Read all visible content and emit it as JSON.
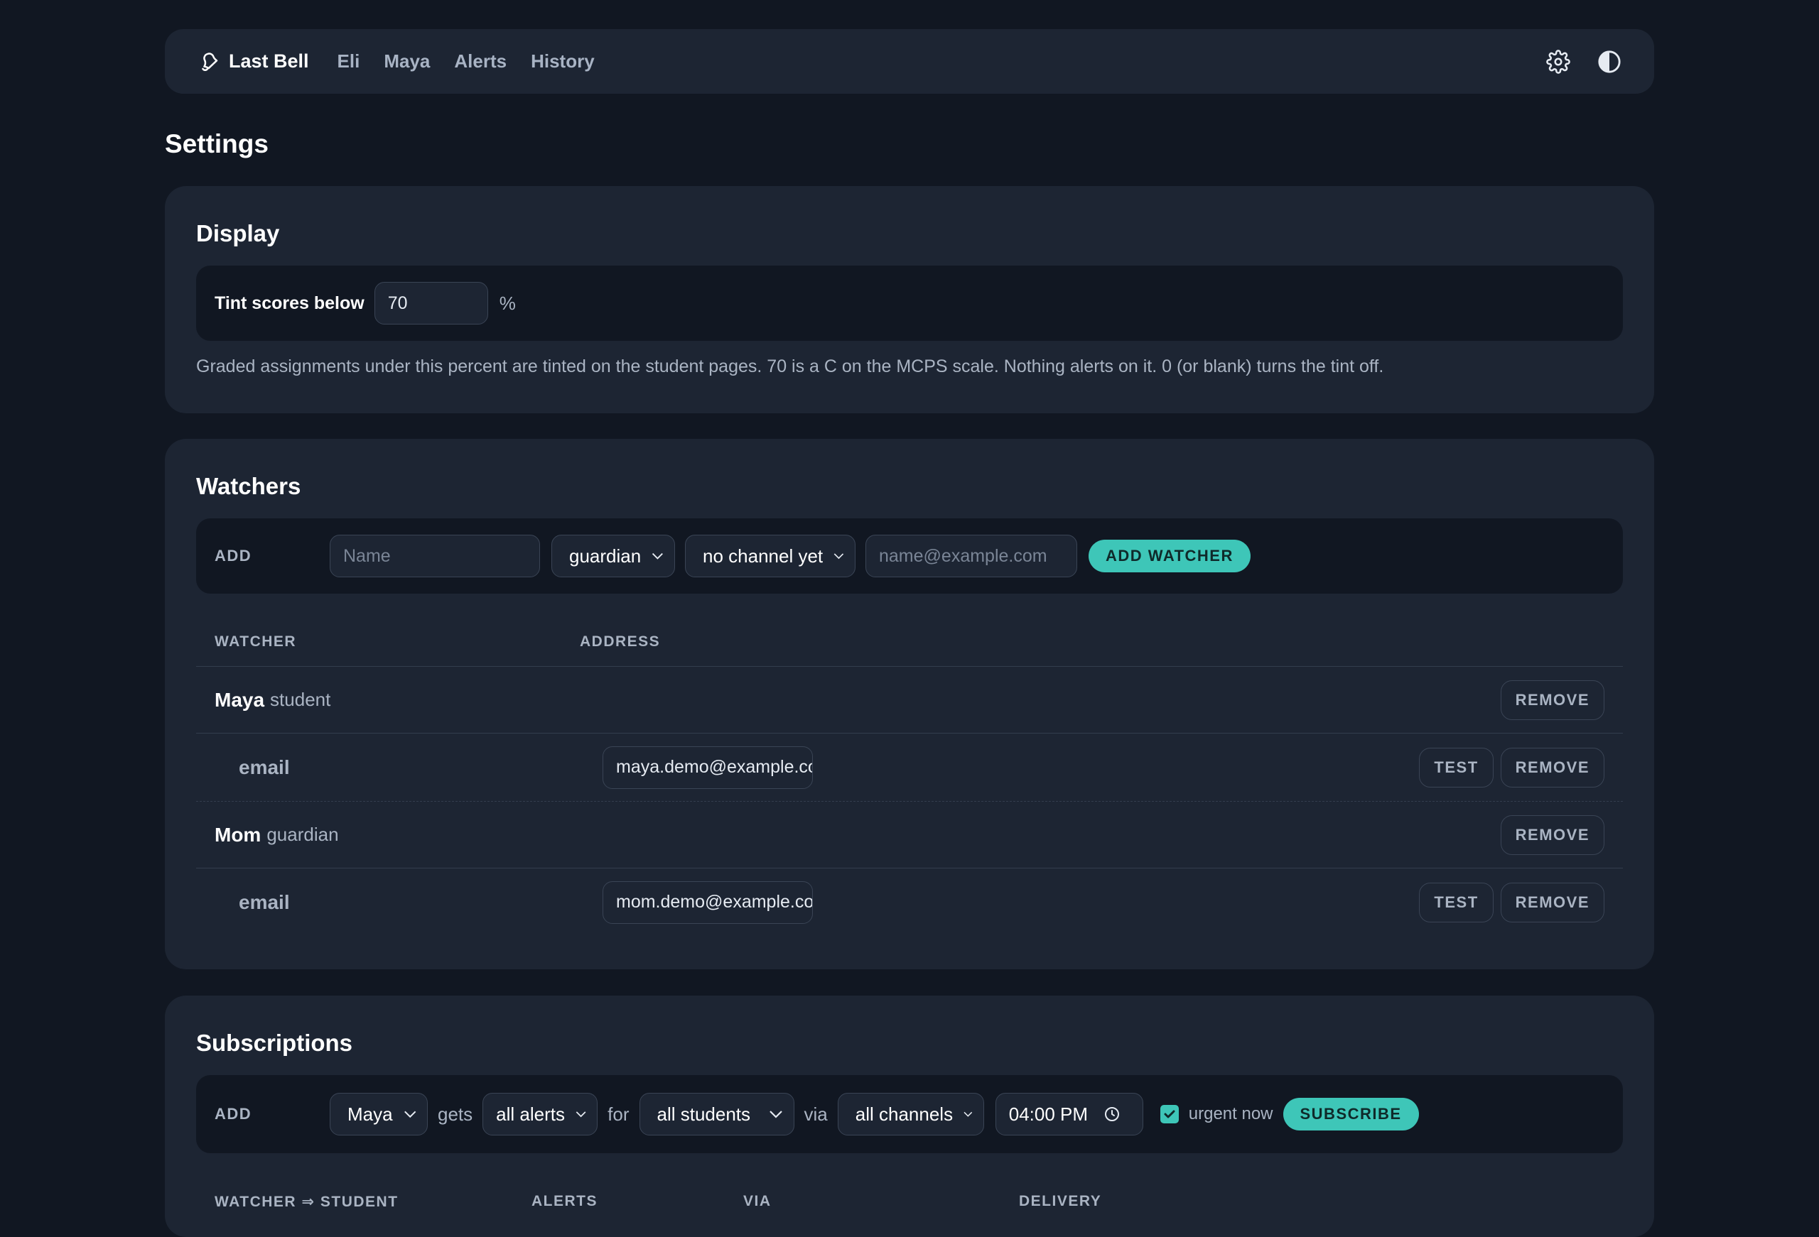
{
  "nav": {
    "brand": "Last Bell",
    "links": [
      "Eli",
      "Maya",
      "Alerts",
      "History"
    ]
  },
  "page_title": "Settings",
  "display": {
    "title": "Display",
    "tint_label": "Tint scores below",
    "tint_value": "70",
    "percent_sign": "%",
    "help": "Graded assignments under this percent are tinted on the student pages. 70 is a C on the MCPS scale. Nothing alerts on it. 0 (or blank) turns the tint off."
  },
  "watchers": {
    "title": "Watchers",
    "add_label": "ADD",
    "name_placeholder": "Name",
    "role_value": "guardian",
    "channel_value": "no channel yet",
    "email_placeholder": "name@example.com",
    "add_button": "ADD WATCHER",
    "col_watcher": "WATCHER",
    "col_address": "ADDRESS",
    "remove_label": "REMOVE",
    "test_label": "TEST",
    "rows": [
      {
        "name": "Maya",
        "role": "student",
        "channel": "email",
        "address": "maya.demo@example.com"
      },
      {
        "name": "Mom",
        "role": "guardian",
        "channel": "email",
        "address": "mom.demo@example.com"
      }
    ]
  },
  "subscriptions": {
    "title": "Subscriptions",
    "add_label": "ADD",
    "watcher_value": "Maya",
    "gets_word": "gets",
    "alerts_value": "all alerts",
    "for_word": "for",
    "students_value": "all students",
    "via_word": "via",
    "channels_value": "all channels",
    "time_value": "04:00 PM",
    "urgent_label": "urgent now",
    "urgent_checked": true,
    "subscribe_button": "SUBSCRIBE",
    "col_watcher_student": "WATCHER ⇒ STUDENT",
    "col_alerts": "ALERTS",
    "col_via": "VIA",
    "col_delivery": "DELIVERY"
  },
  "colors": {
    "page_bg": "#111722",
    "card_bg": "#1d2533",
    "accent": "#3ec6b8"
  }
}
